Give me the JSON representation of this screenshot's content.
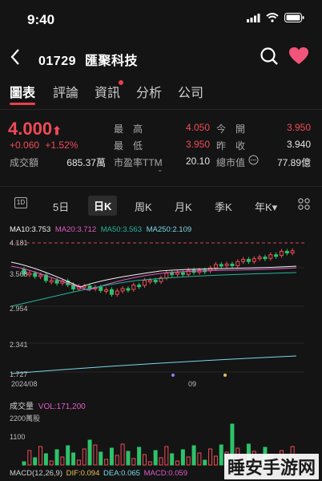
{
  "status_bar": {
    "time": "9:40"
  },
  "header": {
    "code": "01729",
    "name": "匯聚科技"
  },
  "tabs": [
    {
      "label": "圖表",
      "active": true
    },
    {
      "label": "評論"
    },
    {
      "label": "資訊",
      "badge": true
    },
    {
      "label": "分析"
    },
    {
      "label": "公司"
    }
  ],
  "quote": {
    "price": "4.000",
    "change": "+0.060",
    "change_pct": "+1.52%",
    "volume_label": "成交額",
    "volume_value": "685.37萬",
    "pe_label": "市盈率TTM",
    "pe_value": "20.10",
    "high_label": "最　高",
    "high_value": "4.050",
    "low_label": "最　低",
    "low_value": "3.950",
    "open_label": "今　開",
    "open_value": "3.950",
    "prev_close_label": "昨　收",
    "prev_close_value": "3.940",
    "mktcap_label": "總市值",
    "mktcap_value": "77.89億"
  },
  "periods": [
    {
      "label": "1D"
    },
    {
      "label": "5日"
    },
    {
      "label": "日K",
      "active": true
    },
    {
      "label": "周K"
    },
    {
      "label": "月K"
    },
    {
      "label": "季K"
    },
    {
      "label": "年K▾"
    }
  ],
  "ma_legend": {
    "ma10": "MA10:3.753",
    "ma20": "MA20:3.712",
    "ma50": "MA50:3.563",
    "ma250": "MA250:2.109"
  },
  "price_axis": [
    "4.181",
    "3.568",
    "2.954",
    "2.341",
    "1.727"
  ],
  "date_labels": [
    "2024/08",
    "09"
  ],
  "volume": {
    "title": "成交量",
    "value": "VOL:171,200",
    "max_label": "2200萬股",
    "mid_label": "1100"
  },
  "macd": {
    "label": "MACD(12,26,9)",
    "dif": "DIF:0.094",
    "dea": "DEA:0.065",
    "macd": "MACD:0.059"
  },
  "watermark": "睡安手游网",
  "colors": {
    "up": "#ef4b57",
    "down": "#2ec26a",
    "ma10": "#f2f2f2",
    "ma20": "#e05cc8",
    "ma50": "#26b59a",
    "ma250": "#7ad9e8",
    "accent": "#e8404f"
  }
}
